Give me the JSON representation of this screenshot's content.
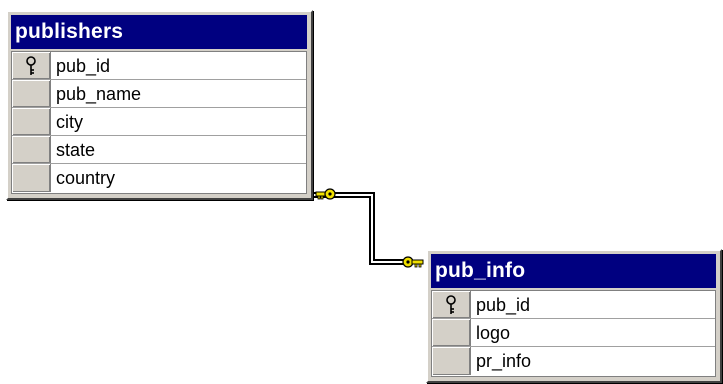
{
  "tables": [
    {
      "name": "publishers",
      "columns": [
        {
          "name": "pub_id",
          "primary_key": true
        },
        {
          "name": "pub_name",
          "primary_key": false
        },
        {
          "name": "city",
          "primary_key": false
        },
        {
          "name": "state",
          "primary_key": false
        },
        {
          "name": "country",
          "primary_key": false
        }
      ]
    },
    {
      "name": "pub_info",
      "columns": [
        {
          "name": "pub_id",
          "primary_key": true
        },
        {
          "name": "logo",
          "primary_key": false
        },
        {
          "name": "pr_info",
          "primary_key": false
        }
      ]
    }
  ],
  "relationship": {
    "from_table": "pub_info",
    "to_table": "publishers",
    "end_icon": "key-icon",
    "line_color": "#000000",
    "key_color": "#f0e000"
  },
  "colors": {
    "title_bar": "#000080",
    "title_text": "#ffffff",
    "frame": "#d4d0c8"
  }
}
